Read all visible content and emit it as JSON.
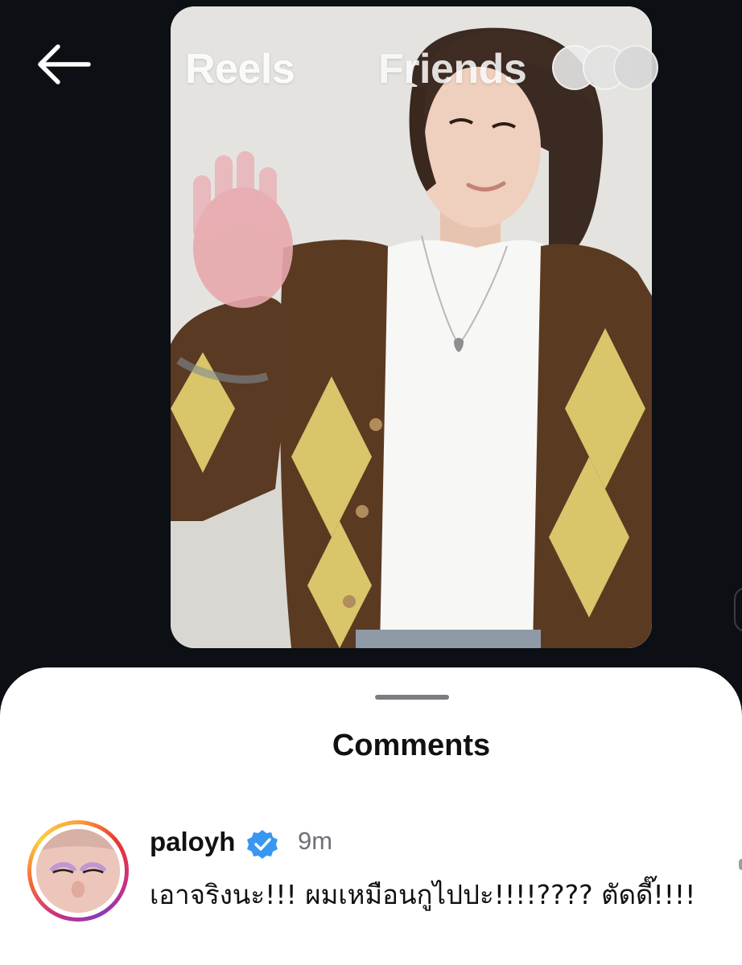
{
  "header": {
    "tabs": [
      "Reels",
      "Friends"
    ],
    "back_icon": "arrow-left-icon"
  },
  "reel": {
    "description": "video-thumbnail"
  },
  "comments_sheet": {
    "title": "Comments",
    "comments": [
      {
        "username": "paloyh",
        "verified": true,
        "time": "9m",
        "text": "เอาจริงนะ!!! ผมเหมือนกูไปปะ!!!!???? ตัดดี๊!!!!"
      }
    ]
  },
  "colors": {
    "background": "#0c0f14",
    "sheet": "#ffffff",
    "verified_badge": "#3897f0"
  }
}
